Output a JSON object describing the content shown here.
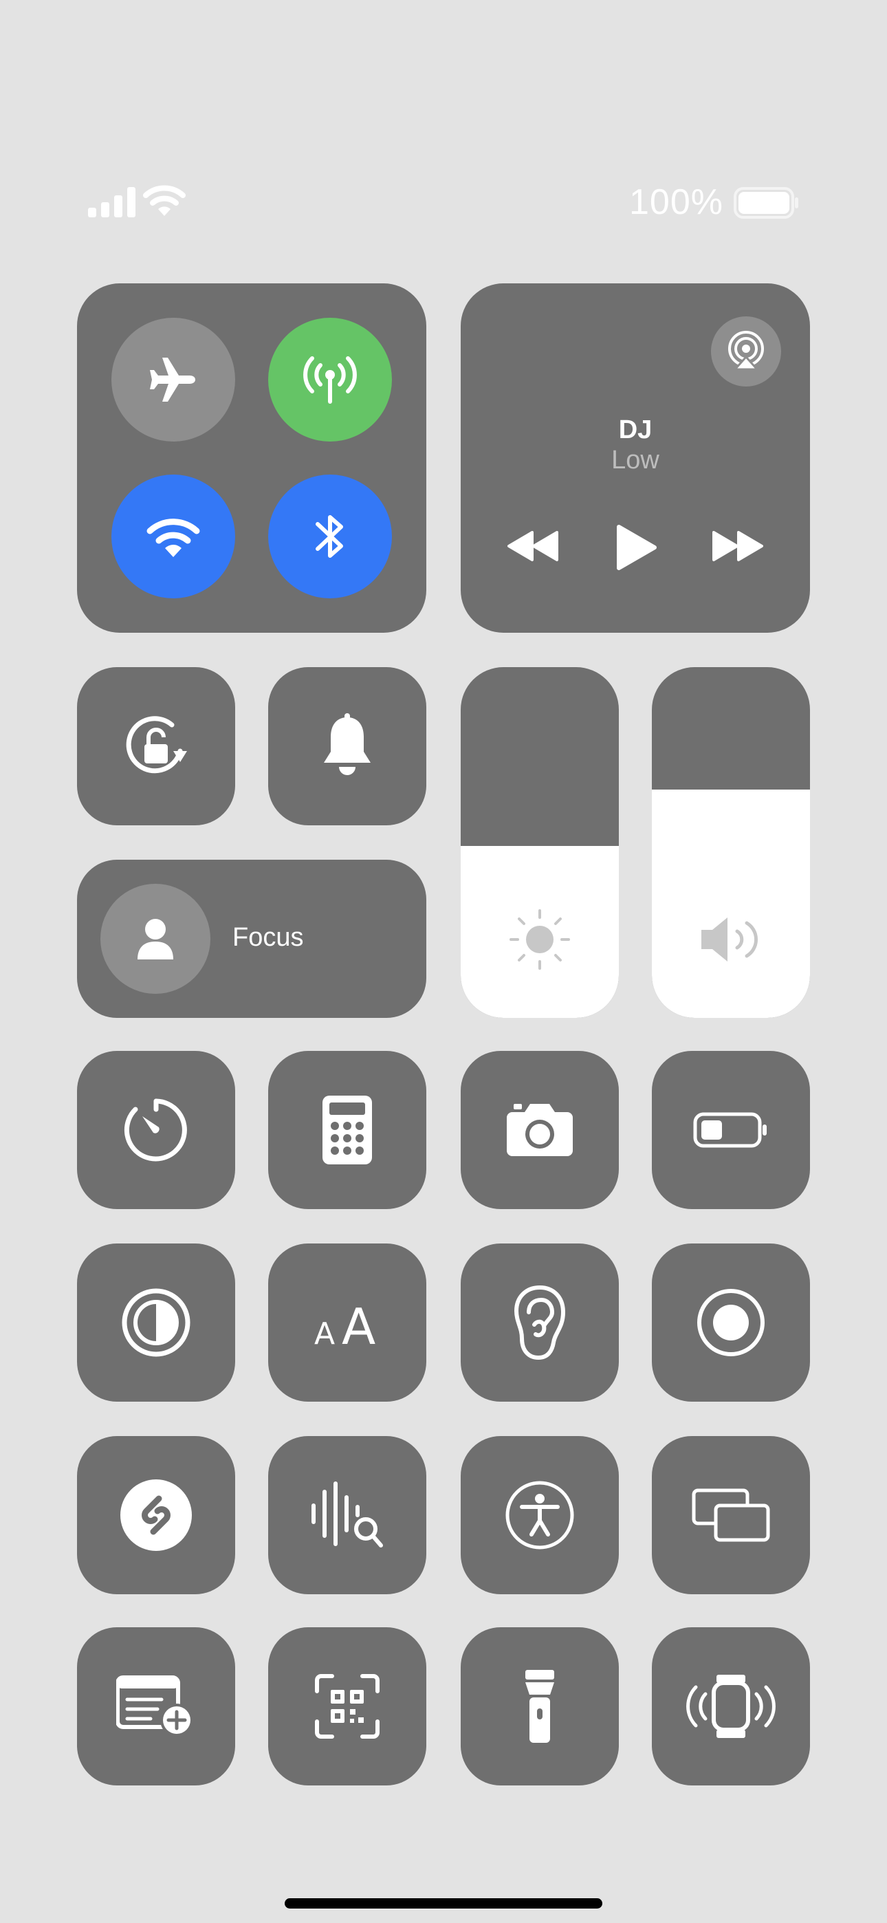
{
  "status_bar": {
    "battery_percent": "100%",
    "icons": [
      "cellular-signal-icon",
      "wifi-status-icon",
      "battery-icon"
    ]
  },
  "connectivity": {
    "airplane": {
      "icon": "airplane-icon",
      "state": "off",
      "color": "#8e8e8e"
    },
    "cellular": {
      "icon": "cellular-data-icon",
      "state": "on",
      "color": "#65c466"
    },
    "wifi": {
      "icon": "wifi-icon",
      "state": "on",
      "color": "#3478f6"
    },
    "bluetooth": {
      "icon": "bluetooth-icon",
      "state": "on",
      "color": "#3478f6"
    }
  },
  "now_playing": {
    "title": "DJ",
    "subtitle": "Low",
    "icons": [
      "airplay-icon",
      "rewind-icon",
      "play-icon",
      "fast-forward-icon"
    ]
  },
  "controls": {
    "orientation_lock": {
      "icon": "rotation-lock-icon"
    },
    "silent_mode": {
      "icon": "bell-icon"
    },
    "focus": {
      "label": "Focus",
      "icon": "person-icon"
    }
  },
  "sliders": {
    "brightness": {
      "icon": "sun-icon",
      "level_percent": 49
    },
    "volume": {
      "icon": "speaker-icon",
      "level_percent": 65
    }
  },
  "shortcuts": [
    [
      "timer-icon",
      "calculator-icon",
      "camera-icon",
      "low-power-mode-icon"
    ],
    [
      "dark-mode-icon",
      "text-size-icon",
      "hearing-icon",
      "screen-record-icon"
    ],
    [
      "shazam-icon",
      "sound-recognition-icon",
      "accessibility-shortcut-icon",
      "screen-mirroring-icon"
    ],
    [
      "quick-note-icon",
      "code-scanner-icon",
      "flashlight-icon",
      "ping-watch-icon"
    ]
  ],
  "colors": {
    "background": "#e3e3e3",
    "tile": "#6f6f6f",
    "slider_fill": "#ffffff",
    "green": "#65c466",
    "blue": "#3478f6"
  }
}
